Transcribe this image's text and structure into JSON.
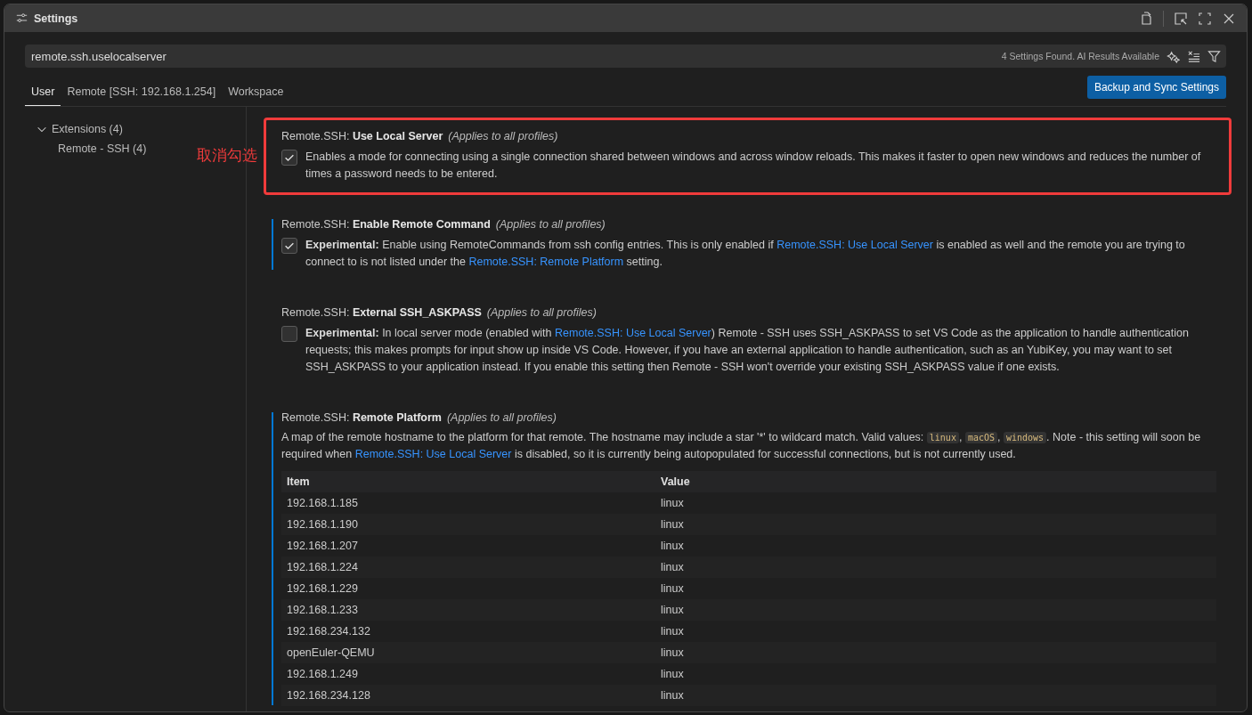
{
  "window": {
    "title": "Settings"
  },
  "search": {
    "value": "remote.ssh.uselocalserver",
    "result_count": "4 Settings Found. AI Results Available"
  },
  "scope_tabs": [
    {
      "label": "User",
      "selected": true
    },
    {
      "label": "Remote [SSH: 192.168.1.254]",
      "selected": false
    },
    {
      "label": "Workspace",
      "selected": false
    }
  ],
  "sync_button": "Backup and Sync Settings",
  "toc": [
    {
      "label": "Extensions (4)",
      "expanded": true,
      "children": [
        {
          "label": "Remote - SSH (4)"
        }
      ]
    }
  ],
  "settings": [
    {
      "kind": "checkbox",
      "category": "Remote.SSH:",
      "title": "Use Local Server",
      "scope": "(Applies to all profiles)",
      "modified": false,
      "highlighted": true,
      "annotation": "取消勾选",
      "checked": true,
      "description": [
        {
          "kind": "text",
          "text": "Enables a mode for connecting using a single connection shared between windows and across window reloads. This makes it faster to open new windows and reduces the number of times a password needs to be entered."
        }
      ]
    },
    {
      "kind": "checkbox",
      "category": "Remote.SSH:",
      "title": "Enable Remote Command",
      "scope": "(Applies to all profiles)",
      "modified": true,
      "highlighted": false,
      "checked": true,
      "description": [
        {
          "kind": "text",
          "text": "**Experimental:** Enable using RemoteCommands from ssh config entries. This is only enabled if "
        },
        {
          "kind": "link",
          "text": "Remote.SSH: Use Local Server"
        },
        {
          "kind": "text",
          "text": " is enabled as well and the remote you are trying to connect to is not listed under the "
        },
        {
          "kind": "link",
          "text": "Remote.SSH: Remote Platform"
        },
        {
          "kind": "text",
          "text": " setting."
        }
      ]
    },
    {
      "kind": "checkbox",
      "category": "Remote.SSH:",
      "title": "External SSH_ASKPASS",
      "scope": "(Applies to all profiles)",
      "modified": false,
      "highlighted": false,
      "checked": false,
      "description": [
        {
          "kind": "text",
          "text": "**Experimental:** In local server mode (enabled with "
        },
        {
          "kind": "link",
          "text": "Remote.SSH: Use Local Server"
        },
        {
          "kind": "text",
          "text": ") Remote - SSH uses SSH_ASKPASS to set VS Code as the application to handle authentication requests; this makes prompts for input show up inside VS Code. However, if you have an external application to handle authentication, such as an YubiKey, you may want to set SSH_ASKPASS to your application instead. If you enable this setting then Remote - SSH won't override your existing SSH_ASKPASS value if one exists."
        }
      ]
    },
    {
      "kind": "table",
      "category": "Remote.SSH:",
      "title": "Remote Platform",
      "scope": "(Applies to all profiles)",
      "modified": true,
      "highlighted": false,
      "description": [
        {
          "kind": "text",
          "text": "A map of the remote hostname to the platform for that remote. The hostname may include a star '*' to wildcard match. Valid values: "
        },
        {
          "kind": "code",
          "text": "linux"
        },
        {
          "kind": "text",
          "text": ", "
        },
        {
          "kind": "code",
          "text": "macOS"
        },
        {
          "kind": "text",
          "text": ", "
        },
        {
          "kind": "code",
          "text": "windows"
        },
        {
          "kind": "text",
          "text": ". Note - this setting will soon be required when "
        },
        {
          "kind": "link",
          "text": "Remote.SSH: Use Local Server"
        },
        {
          "kind": "text",
          "text": " is disabled, so it is currently being autopopulated for successful connections, but is not currently used."
        }
      ],
      "table": {
        "columns": [
          "Item",
          "Value"
        ],
        "rows": [
          [
            "192.168.1.185",
            "linux"
          ],
          [
            "192.168.1.190",
            "linux"
          ],
          [
            "192.168.1.207",
            "linux"
          ],
          [
            "192.168.1.224",
            "linux"
          ],
          [
            "192.168.1.229",
            "linux"
          ],
          [
            "192.168.1.233",
            "linux"
          ],
          [
            "192.168.234.132",
            "linux"
          ],
          [
            "openEuler-QEMU",
            "linux"
          ],
          [
            "192.168.1.249",
            "linux"
          ],
          [
            "192.168.234.128",
            "linux"
          ]
        ]
      }
    }
  ]
}
